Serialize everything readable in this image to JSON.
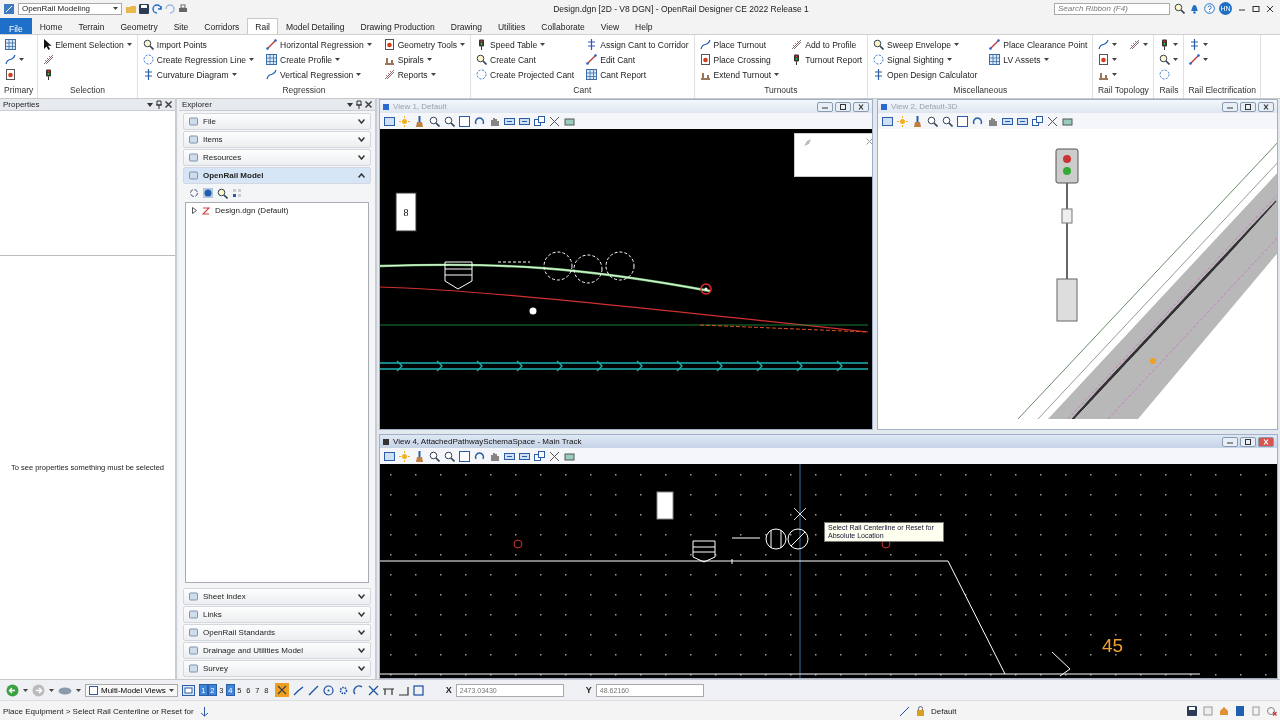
{
  "title_bar": {
    "workspace": "OpenRail Modeling",
    "title": "Design.dgn [2D - V8 DGN] - OpenRail Designer CE 2022 Release 1",
    "search_placeholder": "Search Ribbon (F4)",
    "user_initials": "HN"
  },
  "ribbon_tabs": [
    {
      "label": "File",
      "kind": "file",
      "selected": false
    },
    {
      "label": "Home",
      "kind": "tab",
      "selected": false
    },
    {
      "label": "Terrain",
      "kind": "tab",
      "selected": false
    },
    {
      "label": "Geometry",
      "kind": "tab",
      "selected": false
    },
    {
      "label": "Site",
      "kind": "tab",
      "selected": false
    },
    {
      "label": "Corridors",
      "kind": "tab",
      "selected": false
    },
    {
      "label": "Rail",
      "kind": "tab",
      "selected": true
    },
    {
      "label": "Model Detailing",
      "kind": "tab",
      "selected": false
    },
    {
      "label": "Drawing Production",
      "kind": "tab",
      "selected": false
    },
    {
      "label": "Drawing",
      "kind": "tab",
      "selected": false
    },
    {
      "label": "Utilities",
      "kind": "tab",
      "selected": false
    },
    {
      "label": "Collaborate",
      "kind": "tab",
      "selected": false
    },
    {
      "label": "View",
      "kind": "tab",
      "selected": false
    },
    {
      "label": "Help",
      "kind": "tab",
      "selected": false
    }
  ],
  "ribbon_groups": [
    {
      "label": "Primary",
      "items": [
        {
          "kind": "icon",
          "dropdown": false
        },
        {
          "kind": "icon",
          "dropdown": true
        },
        {
          "kind": "icon",
          "dropdown": false
        }
      ]
    },
    {
      "label": "Selection",
      "items": [
        {
          "kind": "button",
          "label": "Element Selection",
          "dropdown": true
        },
        {
          "kind": "icon",
          "dropdown": false
        },
        {
          "kind": "icon",
          "dropdown": false
        }
      ]
    },
    {
      "label": "Regression",
      "items": [
        {
          "kind": "button",
          "label": "Import Points",
          "dropdown": false
        },
        {
          "kind": "button",
          "label": "Create Regression Line",
          "dropdown": true
        },
        {
          "kind": "button",
          "label": "Curvature Diagram",
          "dropdown": true
        },
        {
          "kind": "button",
          "label": "Horizontal Regression",
          "dropdown": true
        },
        {
          "kind": "button",
          "label": "Create Profile",
          "dropdown": true
        },
        {
          "kind": "button",
          "label": "Vertical Regression",
          "dropdown": true
        },
        {
          "kind": "button",
          "label": "Geometry Tools",
          "dropdown": true
        },
        {
          "kind": "button",
          "label": "Spirals",
          "dropdown": true
        },
        {
          "kind": "button",
          "label": "Reports",
          "dropdown": true
        }
      ]
    },
    {
      "label": "Cant",
      "items": [
        {
          "kind": "button",
          "label": "Speed Table",
          "dropdown": true
        },
        {
          "kind": "button",
          "label": "Create Cant",
          "dropdown": false
        },
        {
          "kind": "button",
          "label": "Create Projected Cant",
          "dropdown": false
        },
        {
          "kind": "button",
          "label": "Assign Cant to Corridor",
          "dropdown": false
        },
        {
          "kind": "button",
          "label": "Edit Cant",
          "dropdown": false
        },
        {
          "kind": "button",
          "label": "Cant Report",
          "dropdown": false
        }
      ]
    },
    {
      "label": "Turnouts",
      "items": [
        {
          "kind": "button",
          "label": "Place Turnout",
          "dropdown": false
        },
        {
          "kind": "button",
          "label": "Place Crossing",
          "dropdown": false
        },
        {
          "kind": "button",
          "label": "Extend Turnout",
          "dropdown": true
        },
        {
          "kind": "button",
          "label": "Add to Profile",
          "dropdown": false
        },
        {
          "kind": "button",
          "label": "Turnout Report",
          "dropdown": false
        }
      ]
    },
    {
      "label": "Miscellaneous",
      "items": [
        {
          "kind": "button",
          "label": "Sweep Envelope",
          "dropdown": true
        },
        {
          "kind": "button",
          "label": "Signal Sighting",
          "dropdown": true
        },
        {
          "kind": "button",
          "label": "Open Design Calculator",
          "dropdown": false
        },
        {
          "kind": "button",
          "label": "Place Clearance Point",
          "dropdown": false
        },
        {
          "kind": "button",
          "label": "LV Assets",
          "dropdown": true
        }
      ]
    },
    {
      "label": "Rail Topology",
      "items": [
        {
          "kind": "icon",
          "dropdown": true
        },
        {
          "kind": "icon",
          "dropdown": true
        },
        {
          "kind": "icon",
          "dropdown": true
        },
        {
          "kind": "icon",
          "dropdown": true
        }
      ]
    },
    {
      "label": "Rails",
      "items": [
        {
          "kind": "icon",
          "dropdown": true
        },
        {
          "kind": "icon",
          "dropdown": true
        },
        {
          "kind": "icon",
          "dropdown": false
        }
      ]
    },
    {
      "label": "Rail Electrification",
      "items": [
        {
          "kind": "icon",
          "dropdown": true
        },
        {
          "kind": "icon",
          "dropdown": true
        }
      ]
    }
  ],
  "properties": {
    "title": "Properties",
    "message": "To see properties something must be selected"
  },
  "explorer": {
    "title": "Explorer",
    "sections": [
      {
        "label": "File",
        "expanded": false
      },
      {
        "label": "Items",
        "expanded": false
      },
      {
        "label": "Resources",
        "expanded": false
      },
      {
        "label": "OpenRail Model",
        "expanded": true,
        "tree": [
          {
            "label": "Design.dgn (Default)",
            "expanded": false
          }
        ]
      }
    ],
    "bottom_sections": [
      {
        "label": "Sheet Index",
        "expanded": false
      },
      {
        "label": "Links",
        "expanded": false
      },
      {
        "label": "OpenRail Standards",
        "expanded": false
      },
      {
        "label": "Drainage and Utilities Model",
        "expanded": false
      },
      {
        "label": "Survey",
        "expanded": false
      }
    ]
  },
  "views": [
    {
      "title": "View 1, Default",
      "kind": "plan",
      "active": false,
      "marker_label": "8"
    },
    {
      "title": "View 2, Default-3D",
      "kind": "perspective",
      "active": false
    },
    {
      "title": "View 4, AttachedPathwaySchemaSpace - Main Track",
      "kind": "schema",
      "active": true,
      "label": "45",
      "tooltip": "Select Rail Centerline or Reset for Absolute Location"
    }
  ],
  "view_toolbar": {
    "view_group": "Multi-Model Views",
    "view_buttons": [
      {
        "label": "1",
        "selected": true
      },
      {
        "label": "2",
        "selected": true
      },
      {
        "label": "3",
        "selected": false
      },
      {
        "label": "4",
        "selected": true
      },
      {
        "label": "5",
        "selected": false
      },
      {
        "label": "6",
        "selected": false
      },
      {
        "label": "7",
        "selected": false
      },
      {
        "label": "8",
        "selected": false
      }
    ],
    "x_label": "X",
    "x_value": "2473.03430",
    "y_label": "Y",
    "y_value": "48.62160"
  },
  "status_bar": {
    "prompt": "Place Equipment > Select Rail Centerline or Reset for",
    "level": "Default"
  }
}
